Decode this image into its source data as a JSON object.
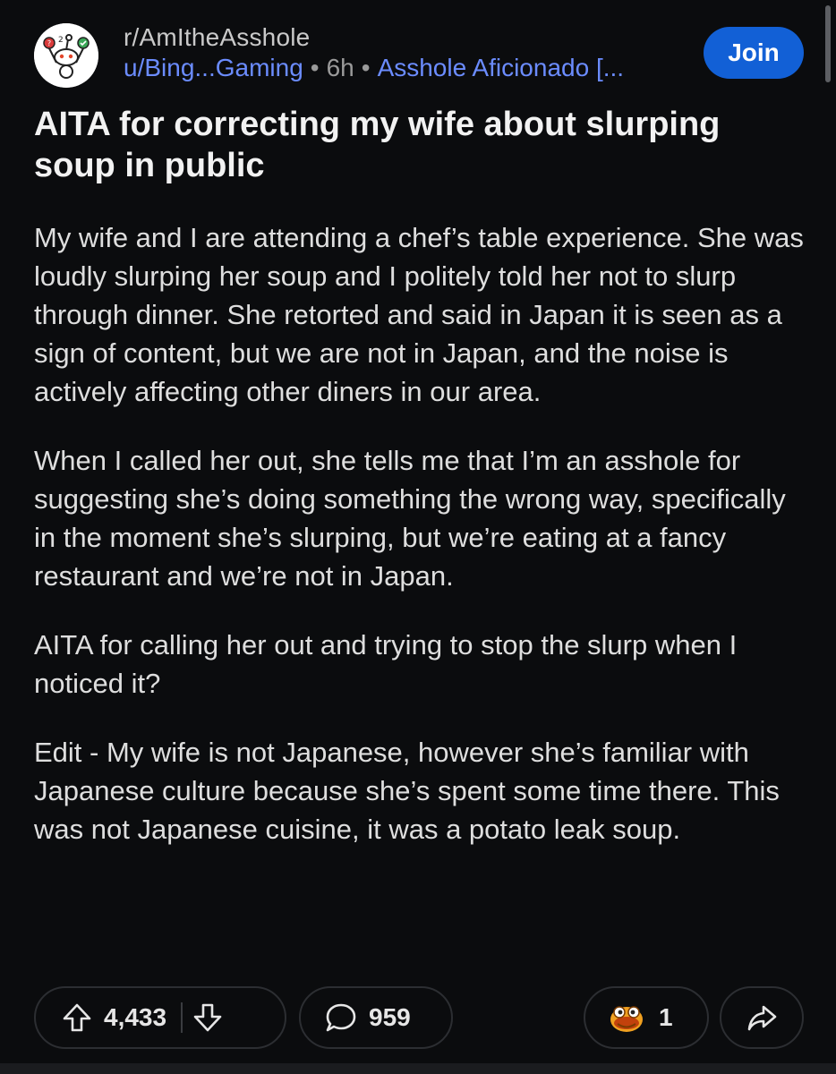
{
  "post": {
    "subreddit": "r/AmItheAsshole",
    "author": "u/Bing...Gaming",
    "separator": "•",
    "time": "6h",
    "flair": "Asshole Aficionado [...",
    "join_label": "Join",
    "title": "AITA for correcting my wife about slurping soup in public",
    "paragraphs": [
      "My wife and I are attending a chef’s table experience. She was loudly slurping her soup and I politely told her not to slurp through dinner. She retorted and said in Japan it is seen as a sign of content, but we are not in Japan, and the noise is actively affecting other diners in our area.",
      "When I called her out, she tells me that I’m an asshole for suggesting she’s doing something the wrong way, specifically in the moment she’s slurping, but we’re eating at a fancy restaurant and we’re not in Japan.",
      "AITA for calling her out and trying to stop the slurp when I noticed it?",
      "Edit - My wife is not Japanese, however she’s familiar with Japanese culture because she’s spent some time there. This was not Japanese cuisine, it was a potato leak soup."
    ]
  },
  "actions": {
    "upvotes": "4,433",
    "comments": "959",
    "awards": "1"
  },
  "icons": {
    "avatar": "snoo-avatar-icon",
    "upvote": "arrow-up-icon",
    "downvote": "arrow-down-icon",
    "comment": "speech-bubble-icon",
    "award": "award-icon",
    "share": "share-arrow-icon"
  },
  "colors": {
    "background": "#0b0c0e",
    "link": "#6b8cff",
    "join_button": "#1260d6"
  }
}
